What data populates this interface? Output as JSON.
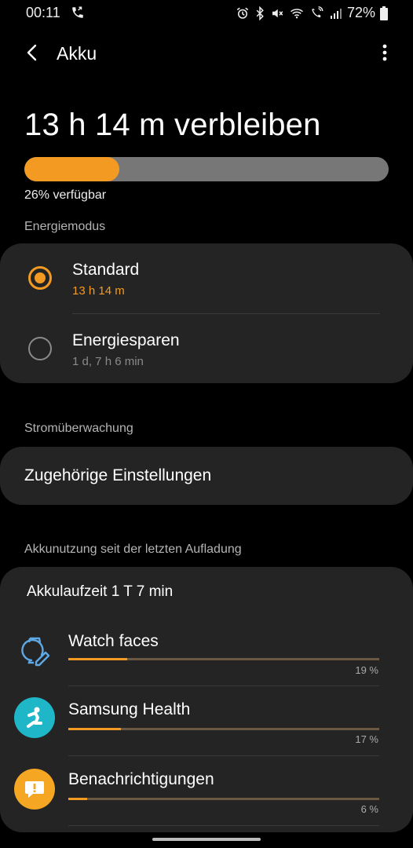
{
  "status_bar": {
    "time": "00:11",
    "battery_percent": "72%",
    "icons": [
      "call-forward-icon",
      "alarm-icon",
      "bluetooth-icon",
      "mute-icon",
      "wifi-icon",
      "wifi-call-icon",
      "signal-icon",
      "battery-icon"
    ]
  },
  "header": {
    "title": "Akku",
    "back_icon": "back-arrow-icon",
    "more_icon": "more-vert-icon"
  },
  "battery": {
    "remaining_text": "13 h 14 m verbleiben",
    "available_text": "26% verfügbar",
    "level_fraction": 0.26,
    "accent_color": "#f39a23",
    "track_color": "#777777"
  },
  "energy_mode": {
    "section_label": "Energiemodus",
    "options": [
      {
        "title": "Standard",
        "subtitle": "13 h 14 m",
        "selected": true
      },
      {
        "title": "Energiesparen",
        "subtitle": "1 d, 7 h 6 min",
        "selected": false
      }
    ]
  },
  "power_monitoring": {
    "section_label": "Stromüberwachung",
    "related_settings": "Zugehörige Einstellungen"
  },
  "usage": {
    "section_label": "Akkunutzung seit der letzten Aufladung",
    "runtime": "Akkulaufzeit 1 T 7 min",
    "apps": [
      {
        "name": "Watch faces",
        "percent_text": "19 %",
        "fraction": 0.19,
        "icon": "watch-face-icon"
      },
      {
        "name": "Samsung Health",
        "percent_text": "17 %",
        "fraction": 0.17,
        "icon": "samsung-health-icon"
      },
      {
        "name": "Benachrichtigungen",
        "percent_text": "6 %",
        "fraction": 0.06,
        "icon": "notification-icon"
      }
    ]
  }
}
